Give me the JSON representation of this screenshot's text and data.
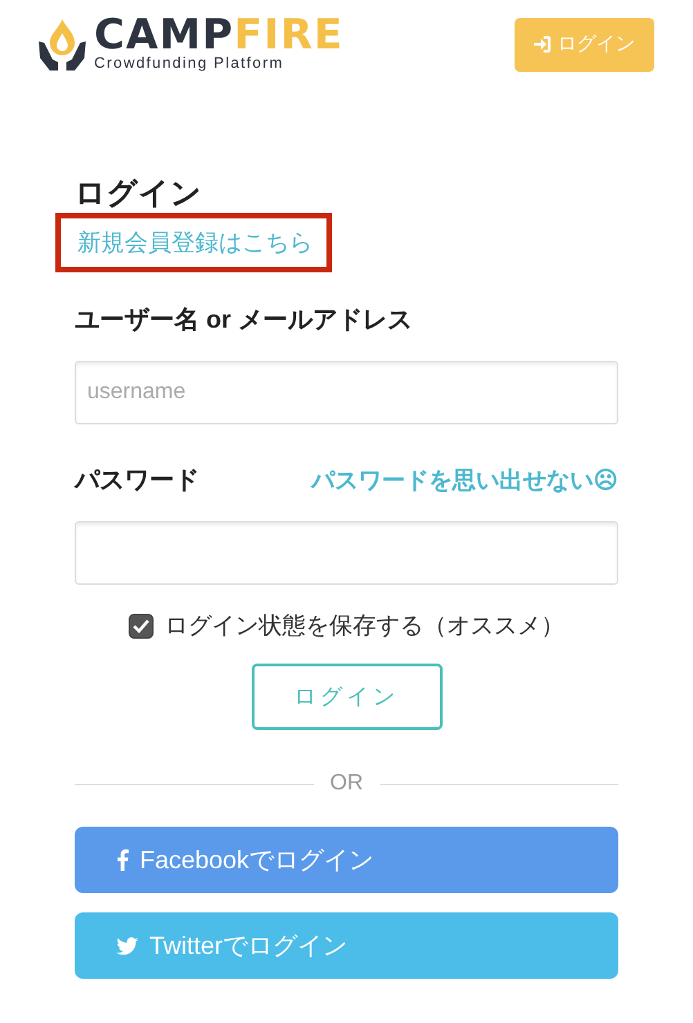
{
  "header": {
    "logo": {
      "word_dark": "CAMP",
      "word_accent": "FIRE",
      "tagline": "Crowdfunding Platform"
    },
    "login_button": "ログイン"
  },
  "form": {
    "title": "ログイン",
    "signup_link": {
      "text": "新規会員登録はこちら",
      "highlighted": true
    },
    "username": {
      "label": "ユーザー名 or メールアドレス",
      "placeholder": "username"
    },
    "password": {
      "label": "パスワード",
      "forgot_link": "パスワードを思い出せない☹"
    },
    "remember": {
      "label": "ログイン状態を保存する（オススメ）",
      "checked": true
    },
    "submit": "ログイン",
    "divider": "OR",
    "social": [
      {
        "kind": "facebook",
        "label": "Facebookでログイン"
      },
      {
        "kind": "twitter",
        "label": "Twitterでログイン"
      }
    ]
  }
}
